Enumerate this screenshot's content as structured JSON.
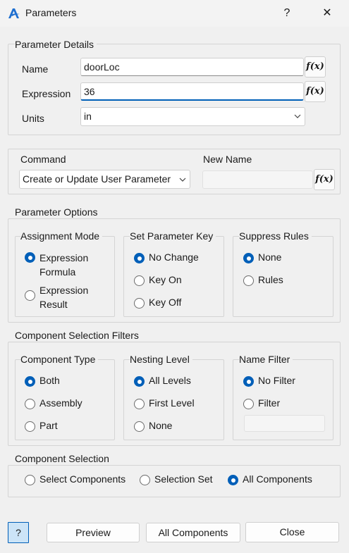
{
  "window": {
    "title": "Parameters",
    "help_glyph": "?",
    "close_glyph": "✕"
  },
  "details": {
    "legend": "Parameter Details",
    "name_label": "Name",
    "name_value": "doorLoc",
    "expression_label": "Expression",
    "expression_value": "36",
    "units_label": "Units",
    "units_value": "in",
    "fx_label": "f(x)"
  },
  "command": {
    "command_label": "Command",
    "command_value": "Create or Update User Parameter",
    "new_name_label": "New Name",
    "new_name_value": ""
  },
  "options": {
    "legend": "Parameter Options",
    "assignment": {
      "legend": "Assignment Mode",
      "items": [
        "Expression Formula",
        "Expression Result"
      ],
      "selected": 0
    },
    "set_key": {
      "legend": "Set Parameter Key",
      "items": [
        "No Change",
        "Key On",
        "Key Off"
      ],
      "selected": 0
    },
    "suppress": {
      "legend": "Suppress Rules",
      "items": [
        "None",
        "Rules"
      ],
      "selected": 0
    }
  },
  "filters": {
    "legend": "Component Selection Filters",
    "component_type": {
      "legend": "Component Type",
      "items": [
        "Both",
        "Assembly",
        "Part"
      ],
      "selected": 0
    },
    "nesting": {
      "legend": "Nesting Level",
      "items": [
        "All Levels",
        "First Level",
        "None"
      ],
      "selected": 0
    },
    "name_filter": {
      "legend": "Name Filter",
      "items": [
        "No Filter",
        "Filter"
      ],
      "selected": 0,
      "filter_value": ""
    }
  },
  "selection": {
    "legend": "Component Selection",
    "items": [
      "Select Components",
      "Selection Set",
      "All Components"
    ],
    "selected": 2
  },
  "footer": {
    "help": "?",
    "preview": "Preview",
    "all_components": "All Components",
    "close": "Close"
  },
  "colors": {
    "accent": "#005fb8",
    "background": "#f0f0f0",
    "icon_blue": "#1e6fd0"
  }
}
